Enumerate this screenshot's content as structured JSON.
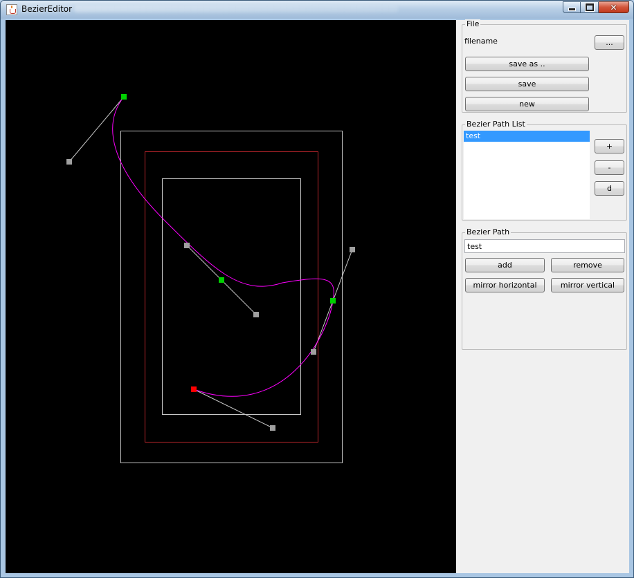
{
  "window": {
    "title": "BezierEditor"
  },
  "canvas": {
    "background": "#000000",
    "frame_colors": {
      "outer": "#c8c8c8",
      "middle": "#c0272d",
      "inner": "#c8c8c8"
    },
    "curve_color": "#ff00ff",
    "anchor_colors": {
      "start": "#ff0000",
      "anchor": "#00d000",
      "handle": "#a0a0a0"
    }
  },
  "file_group": {
    "title": "File",
    "filename_label": "filename",
    "browse_label": "...",
    "save_as_label": "save as ..",
    "save_label": "save",
    "new_label": "new"
  },
  "path_list_group": {
    "title": "Bezier Path List",
    "items": [
      {
        "label": "test",
        "selected": true
      }
    ],
    "add_label": "+",
    "remove_label": "-",
    "duplicate_label": "d"
  },
  "path_group": {
    "title": "Bezier Path",
    "name_value": "test",
    "add_label": "add",
    "remove_label": "remove",
    "mirror_h_label": "mirror horizontal",
    "mirror_v_label": "mirror vertical"
  }
}
